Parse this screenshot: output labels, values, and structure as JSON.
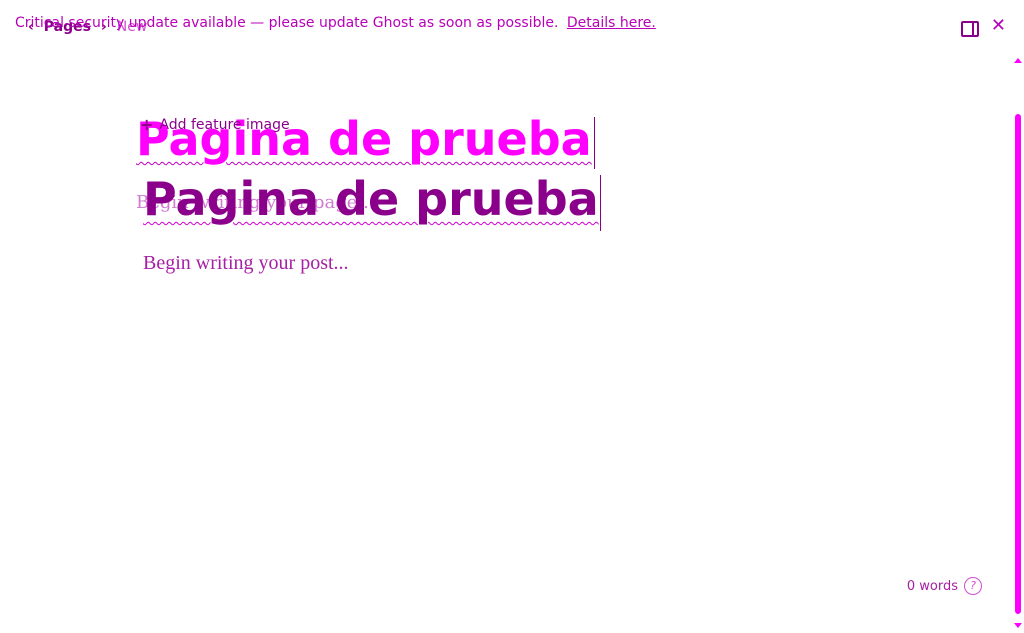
{
  "banner": {
    "message": "Critical security update available — please update Ghost as soon as possible.",
    "link": "Details here."
  },
  "nav": {
    "back_icon": "chevron-left-icon",
    "breadcrumb_parent": "Pages",
    "separator_icon": "chevron-right-icon",
    "breadcrumb_current": "New"
  },
  "toolbar": {
    "settings_icon": "sidebar-toggle-icon",
    "close_icon": "close-icon",
    "close_glyph": "✕"
  },
  "editor": {
    "feature_image_label": "Add feature image",
    "title": "Pagina de prueba",
    "excerpt_placeholder": "Begin writing your page...",
    "body_placeholder": "Begin writing your post..."
  },
  "footer": {
    "word_count": "0 words",
    "help_icon": "help-icon",
    "help_glyph": "?"
  },
  "colors": {
    "accent": "#ff00ff",
    "text_primary": "#8a008a",
    "text_secondary": "#a520a5"
  }
}
